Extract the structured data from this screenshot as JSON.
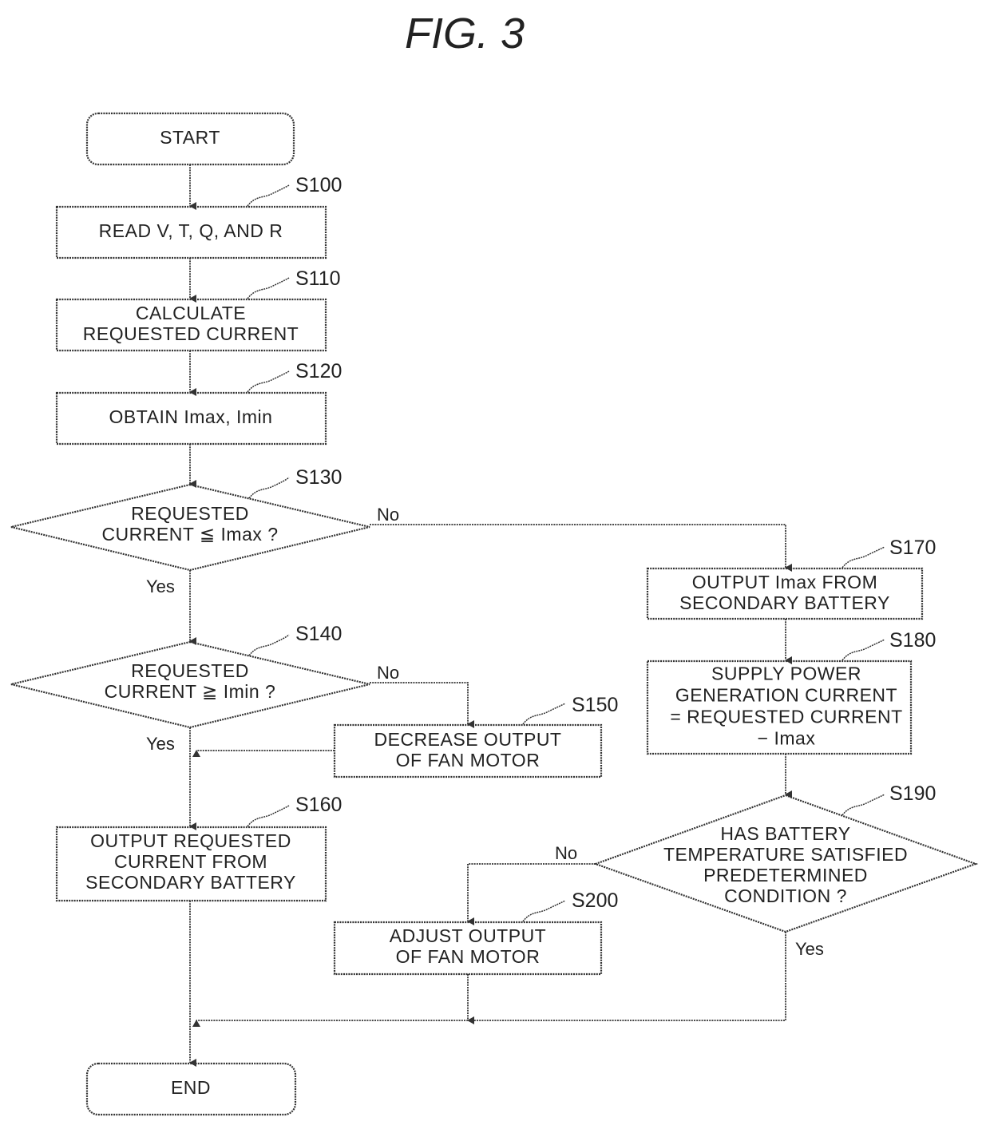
{
  "figure": {
    "title": "FIG. 3"
  },
  "nodes": {
    "start": {
      "lines": [
        "START"
      ]
    },
    "s100": {
      "step": "S100",
      "lines": [
        "READ  V, T, Q, AND  R"
      ]
    },
    "s110": {
      "step": "S110",
      "lines": [
        "CALCULATE",
        "REQUESTED  CURRENT"
      ]
    },
    "s120": {
      "step": "S120",
      "lines": [
        "OBTAIN  Imax, Imin"
      ]
    },
    "s130": {
      "step": "S130",
      "lines": [
        "REQUESTED",
        "CURRENT ≦ Imax ?"
      ]
    },
    "s140": {
      "step": "S140",
      "lines": [
        "REQUESTED",
        "CURRENT ≧ Imin ?"
      ]
    },
    "s150": {
      "step": "S150",
      "lines": [
        "DECREASE  OUTPUT",
        "OF  FAN  MOTOR"
      ]
    },
    "s160": {
      "step": "S160",
      "lines": [
        "OUTPUT  REQUESTED",
        "CURRENT  FROM",
        "SECONDARY  BATTERY"
      ]
    },
    "s170": {
      "step": "S170",
      "lines": [
        "OUTPUT  Imax  FROM",
        "SECONDARY  BATTERY"
      ]
    },
    "s180": {
      "step": "S180",
      "lines": [
        "SUPPLY  POWER",
        "GENERATION  CURRENT",
        "= REQUESTED  CURRENT",
        "− Imax"
      ]
    },
    "s190": {
      "step": "S190",
      "lines": [
        "HAS  BATTERY",
        "TEMPERATURE  SATISFIED",
        "PREDETERMINED",
        "CONDITION ?"
      ]
    },
    "s200": {
      "step": "S200",
      "lines": [
        "ADJUST  OUTPUT",
        "OF  FAN  MOTOR"
      ]
    },
    "end": {
      "lines": [
        "END"
      ]
    }
  },
  "branches": {
    "s130_no": "No",
    "s130_yes": "Yes",
    "s140_no": "No",
    "s140_yes": "Yes",
    "s190_no": "No",
    "s190_yes": "Yes"
  }
}
